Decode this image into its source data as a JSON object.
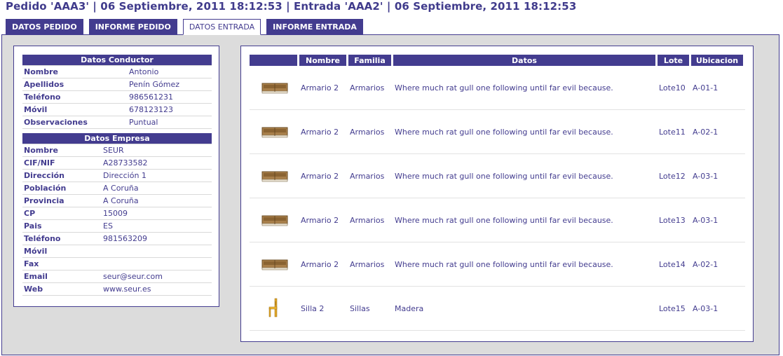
{
  "header": {
    "title": "Pedido 'AAA3' | 06 Septiembre, 2011 18:12:53 | Entrada 'AAA2' | 06 Septiembre, 2011 18:12:53"
  },
  "tabs": [
    {
      "label": "DATOS PEDIDO",
      "active": false
    },
    {
      "label": "INFORME PEDIDO",
      "active": false
    },
    {
      "label": "DATOS ENTRADA",
      "active": true
    },
    {
      "label": "INFORME ENTRADA",
      "active": false
    }
  ],
  "conductor": {
    "heading": "Datos Conductor",
    "rows": [
      {
        "label": "Nombre",
        "value": "Antonio"
      },
      {
        "label": "Apellidos",
        "value": "Penín Gómez"
      },
      {
        "label": "Teléfono",
        "value": "986561231"
      },
      {
        "label": "Móvil",
        "value": "678123123"
      },
      {
        "label": "Observaciones",
        "value": "Puntual"
      }
    ]
  },
  "empresa": {
    "heading": "Datos Empresa",
    "rows": [
      {
        "label": "Nombre",
        "value": "SEUR"
      },
      {
        "label": "CIF/NIF",
        "value": "A28733582"
      },
      {
        "label": "Dirección",
        "value": "Dirección 1"
      },
      {
        "label": "Población",
        "value": "A Coruña"
      },
      {
        "label": "Provincia",
        "value": "A Coruña"
      },
      {
        "label": "CP",
        "value": "15009"
      },
      {
        "label": "Pais",
        "value": "ES"
      },
      {
        "label": "Teléfono",
        "value": "981563209"
      },
      {
        "label": "Móvil",
        "value": ""
      },
      {
        "label": "Fax",
        "value": ""
      },
      {
        "label": "Email",
        "value": "seur@seur.com"
      },
      {
        "label": "Web",
        "value": "www.seur.es"
      }
    ]
  },
  "items": {
    "columns": [
      "",
      "Nombre",
      "Familia",
      "Datos",
      "Lote",
      "Ubicacion"
    ],
    "rows": [
      {
        "icon": "cabinet-icon",
        "nombre": "Armario 2",
        "familia": "Armarios",
        "datos": "Where much rat gull one following until far evil because.",
        "lote": "Lote10",
        "ubicacion": "A-01-1"
      },
      {
        "icon": "cabinet-icon",
        "nombre": "Armario 2",
        "familia": "Armarios",
        "datos": "Where much rat gull one following until far evil because.",
        "lote": "Lote11",
        "ubicacion": "A-02-1"
      },
      {
        "icon": "cabinet-icon",
        "nombre": "Armario 2",
        "familia": "Armarios",
        "datos": "Where much rat gull one following until far evil because.",
        "lote": "Lote12",
        "ubicacion": "A-03-1"
      },
      {
        "icon": "cabinet-icon",
        "nombre": "Armario 2",
        "familia": "Armarios",
        "datos": "Where much rat gull one following until far evil because.",
        "lote": "Lote13",
        "ubicacion": "A-03-1"
      },
      {
        "icon": "cabinet-icon",
        "nombre": "Armario 2",
        "familia": "Armarios",
        "datos": "Where much rat gull one following until far evil because.",
        "lote": "Lote14",
        "ubicacion": "A-02-1"
      },
      {
        "icon": "chair-icon",
        "nombre": "Silla 2",
        "familia": "Sillas",
        "datos": "Madera",
        "lote": "Lote15",
        "ubicacion": "A-03-1"
      }
    ]
  },
  "colors": {
    "accent": "#433c8f",
    "panel_bg": "#dcdcdc"
  }
}
